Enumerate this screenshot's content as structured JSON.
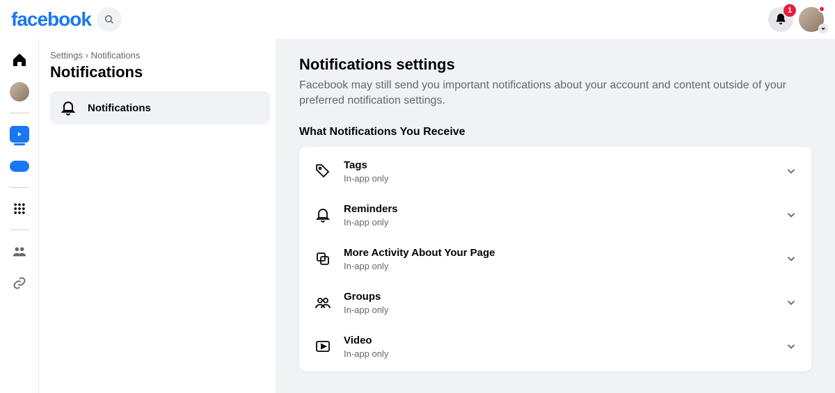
{
  "header": {
    "logo_text": "facebook",
    "notification_badge": "1"
  },
  "settings_panel": {
    "breadcrumb_parent": "Settings",
    "breadcrumb_separator": "›",
    "breadcrumb_current": "Notifications",
    "title": "Notifications",
    "nav_item_label": "Notifications"
  },
  "main": {
    "title": "Notifications settings",
    "description": "Facebook may still send you important notifications about your account and content outside of your preferred notification settings.",
    "section_title": "What Notifications You Receive",
    "items": [
      {
        "title": "Tags",
        "sub": "In-app only"
      },
      {
        "title": "Reminders",
        "sub": "In-app only"
      },
      {
        "title": "More Activity About Your Page",
        "sub": "In-app only"
      },
      {
        "title": "Groups",
        "sub": "In-app only"
      },
      {
        "title": "Video",
        "sub": "In-app only"
      }
    ]
  }
}
